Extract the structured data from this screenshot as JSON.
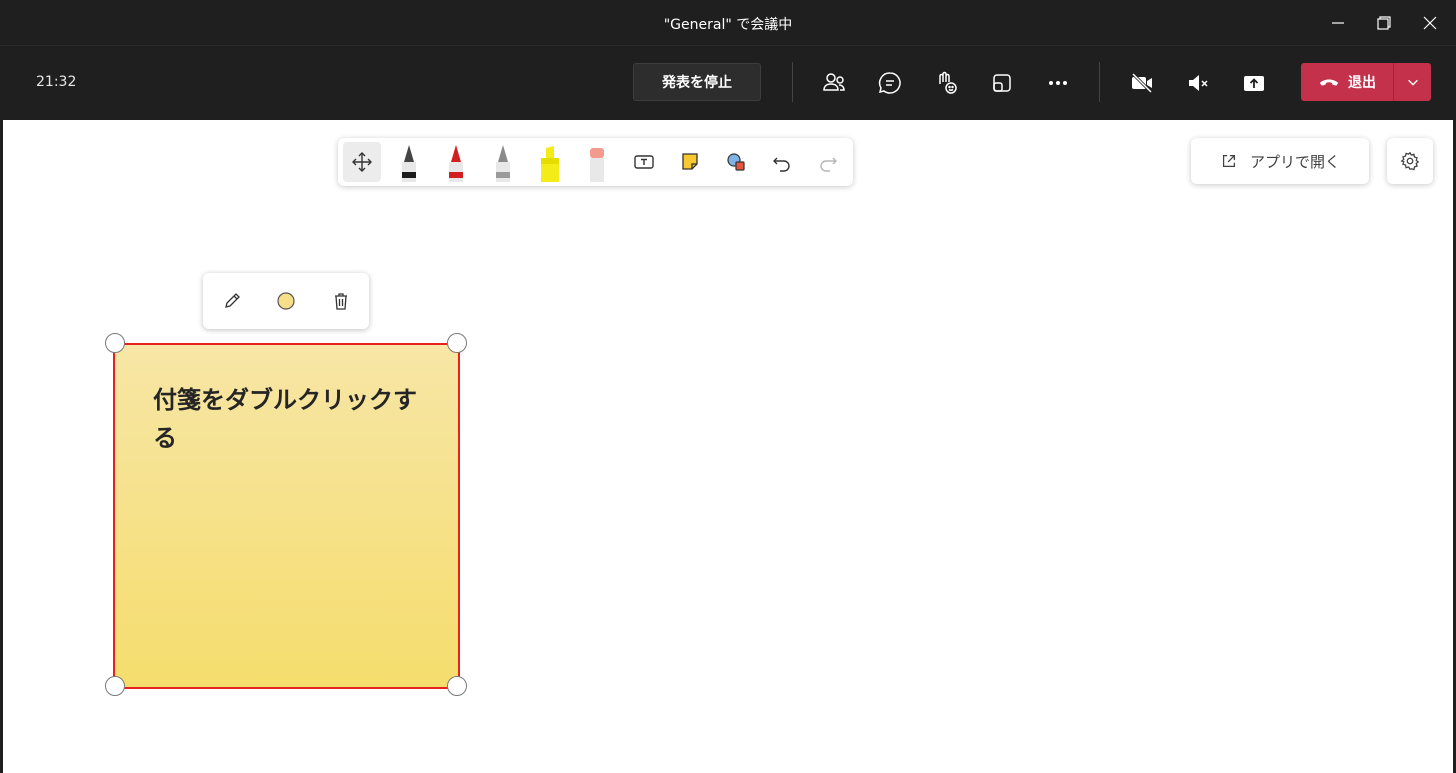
{
  "window": {
    "title": "\"General\" で会議中"
  },
  "meeting_bar": {
    "time": "21:32",
    "stop_presenting_label": "発表を停止",
    "leave_label": "退出",
    "icons": [
      "people-icon",
      "chat-icon",
      "reactions-icon",
      "rooms-icon",
      "more-icon",
      "camera-off-icon",
      "speaker-mute-icon",
      "share-icon"
    ],
    "leave_color": "#c4314b"
  },
  "whiteboard": {
    "tools": [
      "move-icon",
      "black-pen-icon",
      "red-pen-icon",
      "gray-pen-icon",
      "highlighter-icon",
      "eraser-icon",
      "text-icon",
      "sticky-note-icon",
      "shape-icon",
      "undo-icon",
      "redo-icon"
    ],
    "open_in_app_label": "アプリで開く",
    "sticky_note": {
      "text": "付箋をダブルクリックする",
      "color": "#f5dd6d"
    },
    "note_menu": [
      "edit-icon",
      "color-picker-icon",
      "delete-icon"
    ]
  }
}
